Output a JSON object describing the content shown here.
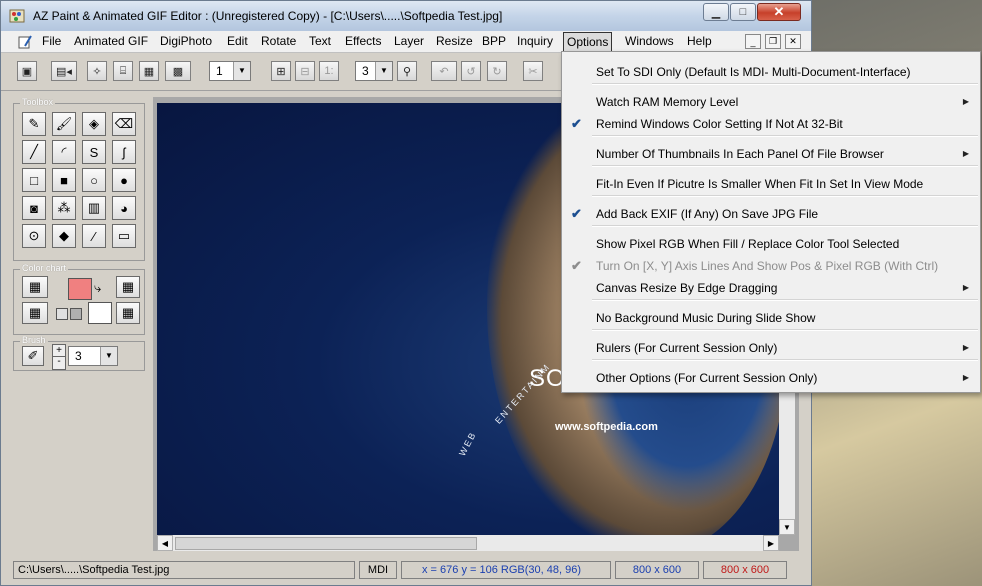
{
  "window": {
    "title": "AZ Paint & Animated GIF Editor : (Unregistered Copy) - [C:\\Users\\.....\\Softpedia Test.jpg]",
    "close_glyph": "✕",
    "min_glyph": "▁",
    "max_glyph": "□"
  },
  "menubar": {
    "items": [
      "File",
      "Animated GIF",
      "DigiPhoto",
      "Edit",
      "Rotate",
      "Text",
      "Effects",
      "Layer",
      "Resize",
      "BPP",
      "Inquiry",
      "Options",
      "Windows",
      "Help"
    ],
    "mdi_min": "_",
    "mdi_restore": "❐",
    "mdi_close": "✕"
  },
  "toolbar": {
    "frame_combo": "1",
    "zoom_combo": "3",
    "ratio_label": "1:"
  },
  "toolbox": {
    "toolbox_label": "Toolbox",
    "color_chart_label": "Color chart",
    "brush_label": "Brush",
    "brush_size": "3",
    "primary_color": "#f08080",
    "secondary_color": "#ffffff"
  },
  "image": {
    "text_so": "SO",
    "text_url": "www.softpedia.com",
    "text_web": "WEB",
    "text_ent": "ENTERTAINM"
  },
  "statusbar": {
    "path": "C:\\Users\\.....\\Softpedia Test.jpg",
    "mode": "MDI",
    "coords": "x = 676   y = 106   RGB(30, 48, 96)",
    "size1": "800 x 600",
    "size2": "800 x 600"
  },
  "options_menu": {
    "items": [
      {
        "label": "Set To SDI Only  (Default Is MDI- Multi-Document-Interface)",
        "checked": false,
        "submenu": false,
        "disabled": false
      },
      {
        "label": "Watch RAM Memory Level",
        "checked": false,
        "submenu": true,
        "disabled": false
      },
      {
        "label": "Remind Windows Color Setting If Not At 32-Bit",
        "checked": true,
        "submenu": false,
        "disabled": false
      },
      {
        "label": "Number Of Thumbnails In Each Panel Of File Browser",
        "checked": false,
        "submenu": true,
        "disabled": false
      },
      {
        "label": "Fit-In Even If Picutre Is Smaller When Fit In Set In View Mode",
        "checked": false,
        "submenu": false,
        "disabled": false
      },
      {
        "label": "Add Back EXIF (If Any) On Save JPG File",
        "checked": true,
        "submenu": false,
        "disabled": false
      },
      {
        "label": "Show Pixel RGB When Fill / Replace Color Tool Selected",
        "checked": false,
        "submenu": false,
        "disabled": false
      },
      {
        "label": "Turn On [X, Y] Axis Lines And Show Pos & Pixel RGB (With Ctrl)",
        "checked": true,
        "submenu": false,
        "disabled": true
      },
      {
        "label": "Canvas Resize By Edge Dragging",
        "checked": false,
        "submenu": true,
        "disabled": false
      },
      {
        "label": "No Background Music During Slide Show",
        "checked": false,
        "submenu": false,
        "disabled": false
      },
      {
        "label": "Rulers  (For Current Session Only)",
        "checked": false,
        "submenu": true,
        "disabled": false
      },
      {
        "label": "Other Options  (For Current Session Only)",
        "checked": false,
        "submenu": true,
        "disabled": false
      }
    ],
    "check_glyph": "✔",
    "submenu_glyph": "▶"
  }
}
